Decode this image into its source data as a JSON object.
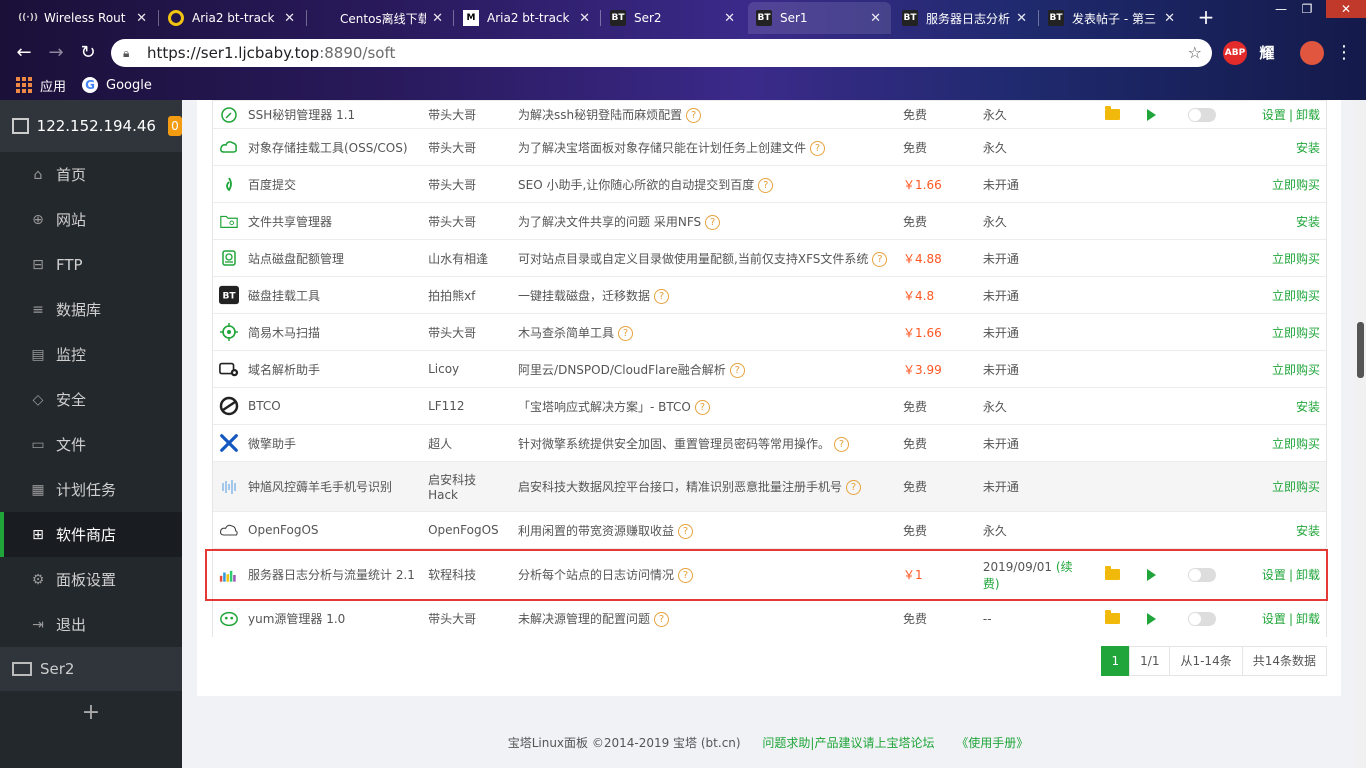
{
  "browser": {
    "tabs": [
      {
        "title": "Wireless Rout",
        "favicon": "wifi-icon",
        "color": "#cccccc"
      },
      {
        "title": "Aria2 bt-track",
        "favicon": "ring-icon",
        "color": "#f1c40f"
      },
      {
        "title": "Centos离线下载",
        "favicon": "github-icon",
        "color": "#333333"
      },
      {
        "title": "Aria2 bt-track",
        "favicon": "medium-icon",
        "color": "#ffffff"
      },
      {
        "title": "Ser2",
        "favicon": "bt-icon",
        "color": "#222222"
      },
      {
        "title": "Ser1",
        "favicon": "bt-icon",
        "color": "#222222"
      },
      {
        "title": "服务器日志分析",
        "favicon": "bt-icon",
        "color": "#222222"
      },
      {
        "title": "发表帖子 - 第三",
        "favicon": "bt-icon",
        "color": "#222222"
      }
    ],
    "active_tab_index": 5,
    "url_host": "https://ser1.ljcbaby.top",
    "url_rest": ":8890/soft",
    "extensions": [
      "ABP",
      "耀"
    ],
    "bookmarks": [
      {
        "label": "应用",
        "icon": "apps-grid-icon"
      },
      {
        "label": "Google",
        "icon": "google-icon"
      }
    ]
  },
  "sidebar": {
    "server_ip": "122.152.194.46",
    "badge": "0",
    "items": [
      {
        "label": "首页",
        "icon": "home-icon",
        "glyph": "⌂",
        "active": false
      },
      {
        "label": "网站",
        "icon": "globe-icon",
        "glyph": "⊕",
        "active": false
      },
      {
        "label": "FTP",
        "icon": "ftp-icon",
        "glyph": "⊟",
        "active": false
      },
      {
        "label": "数据库",
        "icon": "database-icon",
        "glyph": "≡",
        "active": false
      },
      {
        "label": "监控",
        "icon": "monitor-icon",
        "glyph": "▤",
        "active": false
      },
      {
        "label": "安全",
        "icon": "shield-icon",
        "glyph": "◇",
        "active": false
      },
      {
        "label": "文件",
        "icon": "folder-icon",
        "glyph": "▭",
        "active": false
      },
      {
        "label": "计划任务",
        "icon": "calendar-icon",
        "glyph": "▦",
        "active": false
      },
      {
        "label": "软件商店",
        "icon": "grid-icon",
        "glyph": "⊞",
        "active": true
      },
      {
        "label": "面板设置",
        "icon": "gear-icon",
        "glyph": "⚙",
        "active": false
      },
      {
        "label": "退出",
        "icon": "logout-icon",
        "glyph": "⇥",
        "active": false
      }
    ],
    "secondary_server": "Ser2",
    "add_label": "+"
  },
  "table": {
    "rows": [
      {
        "name": "SSH秘钥管理器 1.1",
        "icon": "key-icon",
        "dev": "带头大哥",
        "desc": "为解决ssh秘钥登陆而麻烦配置",
        "price": "免费",
        "price_paid": false,
        "expiry": "永久",
        "installed": true,
        "op": [
          "设置",
          "卸载"
        ]
      },
      {
        "name": "对象存储挂载工具(OSS/COS)",
        "icon": "cloud-icon",
        "dev": "带头大哥",
        "desc": "为了解决宝塔面板对象存储只能在计划任务上创建文件",
        "price": "免费",
        "price_paid": false,
        "expiry": "永久",
        "installed": false,
        "op": [
          "安装"
        ]
      },
      {
        "name": "百度提交",
        "icon": "baidu-icon",
        "dev": "带头大哥",
        "desc": "SEO 小助手,让你随心所欲的自动提交到百度",
        "price": "￥1.66",
        "price_paid": true,
        "expiry": "未开通",
        "installed": false,
        "op": [
          "立即购买"
        ]
      },
      {
        "name": "文件共享管理器",
        "icon": "share-folder-icon",
        "dev": "带头大哥",
        "desc": "为了解决文件共享的问题 采用NFS",
        "price": "免费",
        "price_paid": false,
        "expiry": "永久",
        "installed": false,
        "op": [
          "安装"
        ]
      },
      {
        "name": "站点磁盘配额管理",
        "icon": "disk-icon",
        "dev": "山水有相逢",
        "desc": "可对站点目录或自定义目录做使用量配额,当前仅支持XFS文件系统",
        "price": "￥4.88",
        "price_paid": true,
        "expiry": "未开通",
        "installed": false,
        "op": [
          "立即购买"
        ]
      },
      {
        "name": "磁盘挂载工具",
        "icon": "bt-logo-icon",
        "dev": "拍拍熊xf",
        "desc": "一键挂载磁盘，迁移数据",
        "price": "￥4.8",
        "price_paid": true,
        "expiry": "未开通",
        "installed": false,
        "op": [
          "立即购买"
        ]
      },
      {
        "name": "简易木马扫描",
        "icon": "target-icon",
        "dev": "带头大哥",
        "desc": "木马查杀简单工具",
        "price": "￥1.66",
        "price_paid": true,
        "expiry": "未开通",
        "installed": false,
        "op": [
          "立即购买"
        ]
      },
      {
        "name": "域名解析助手",
        "icon": "dns-icon",
        "dev": "Licoy",
        "desc": "阿里云/DNSPOD/CloudFlare融合解析",
        "price": "￥3.99",
        "price_paid": true,
        "expiry": "未开通",
        "installed": false,
        "op": [
          "立即购买"
        ]
      },
      {
        "name": "BTCO",
        "icon": "btco-icon",
        "dev": "LF112",
        "desc": "「宝塔响应式解决方案」- BTCO",
        "price": "免费",
        "price_paid": false,
        "expiry": "永久",
        "installed": false,
        "op": [
          "安装"
        ]
      },
      {
        "name": "微擎助手",
        "icon": "tools-icon",
        "dev": "超人",
        "desc": "针对微擎系统提供安全加固、重置管理员密码等常用操作。",
        "price": "免费",
        "price_paid": false,
        "expiry": "未开通",
        "installed": false,
        "op": [
          "立即购买"
        ]
      },
      {
        "name": "钟馗风控薅羊毛手机号识别",
        "icon": "wave-icon",
        "dev": "启安科技Hack",
        "dev_line1": "启安科技",
        "dev_line2": "Hack",
        "desc": "启安科技大数据风控平台接口，精准识别恶意批量注册手机号",
        "price": "免费",
        "price_paid": false,
        "expiry": "未开通",
        "installed": false,
        "op": [
          "立即购买"
        ],
        "alt": true
      },
      {
        "name": "OpenFogOS",
        "icon": "fog-cloud-icon",
        "dev": "OpenFogOS",
        "desc": "利用闲置的带宽资源赚取收益",
        "price": "免费",
        "price_paid": false,
        "expiry": "永久",
        "installed": false,
        "op": [
          "安装"
        ]
      },
      {
        "name": "服务器日志分析与流量统计 2.1",
        "icon": "chart-icon",
        "dev": "软程科技",
        "desc": "分析每个站点的日志访问情况",
        "price": "￥1",
        "price_paid": true,
        "expiry": "2019/09/01",
        "renew": "(续费)",
        "installed": true,
        "op": [
          "设置",
          "卸载"
        ],
        "highlight": true
      },
      {
        "name": "yum源管理器 1.0",
        "icon": "yum-icon",
        "dev": "带头大哥",
        "desc": "未解决源管理的配置问题",
        "price": "免费",
        "price_paid": false,
        "expiry": "--",
        "installed": true,
        "op": [
          "设置",
          "卸载"
        ]
      }
    ]
  },
  "pager": {
    "current": "1",
    "pages": "1/1",
    "range": "从1-14条",
    "total": "共14条数据"
  },
  "footer": {
    "copyright": "宝塔Linux面板 ©2014-2019 宝塔 (bt.cn)",
    "link1": "问题求助|产品建议请上宝塔论坛",
    "link2": "《使用手册》"
  },
  "colors": {
    "accent": "#20a53a",
    "price": "#ff5722",
    "highlight": "#e53935",
    "sidebar": "#23282d"
  }
}
